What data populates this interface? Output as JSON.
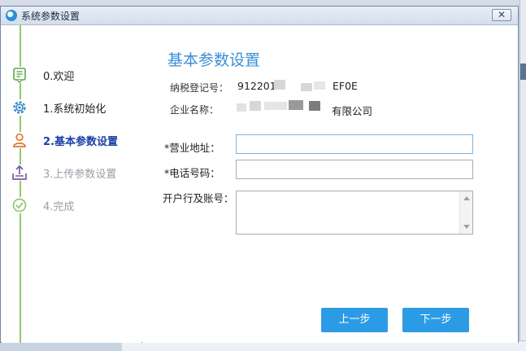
{
  "window": {
    "title": "系统参数设置",
    "close_label": "✕"
  },
  "steps": [
    {
      "label": "0.欢迎",
      "icon": "document-list-icon",
      "state": "done"
    },
    {
      "label": "1.系统初始化",
      "icon": "gear-icon",
      "state": "done"
    },
    {
      "label": "2.基本参数设置",
      "icon": "user-icon",
      "state": "active"
    },
    {
      "label": "3.上传参数设置",
      "icon": "upload-tray-icon",
      "state": "disabled"
    },
    {
      "label": "4.完成",
      "icon": "check-circle-icon",
      "state": "disabled"
    }
  ],
  "main": {
    "title": "基本参数设置",
    "tax_id_label": "纳税登记号：",
    "tax_id_prefix": "912201",
    "tax_id_suffix": "EF0E",
    "company_label": "企业名称：",
    "company_suffix": "有限公司",
    "address_label": "*营业地址：",
    "address_value": "",
    "phone_label": "*电话号码：",
    "phone_value": "",
    "bank_label": "开户行及账号：",
    "bank_value": ""
  },
  "buttons": {
    "prev": "上一步",
    "next": "下一步"
  },
  "colors": {
    "accent": "#2b9be6",
    "title": "#3a8fd6",
    "active_step": "#1a3fa8",
    "rail": "#8fc96b"
  }
}
